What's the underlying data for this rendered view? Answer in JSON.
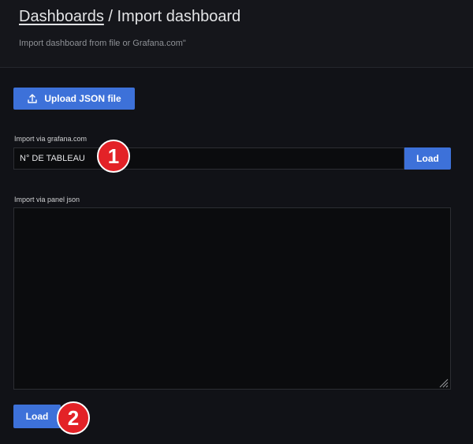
{
  "header": {
    "breadcrumb": "Dashboards",
    "separator": " / ",
    "title": "Import dashboard",
    "subtitle": "Import dashboard from file or Grafana.com\""
  },
  "upload": {
    "label": "Upload JSON file",
    "icon": "upload-icon"
  },
  "grafana_import": {
    "label": "Import via grafana.com",
    "value": "N° DE TABLEAU",
    "load_label": "Load"
  },
  "panel_json": {
    "label": "Import via panel json",
    "value": ""
  },
  "footer": {
    "load_label": "Load"
  },
  "annotations": {
    "marker_1": "1",
    "marker_2": "2"
  },
  "colors": {
    "accent": "#3d71d9",
    "background": "#111217",
    "header_background": "#15161b",
    "marker": "#e32227"
  }
}
